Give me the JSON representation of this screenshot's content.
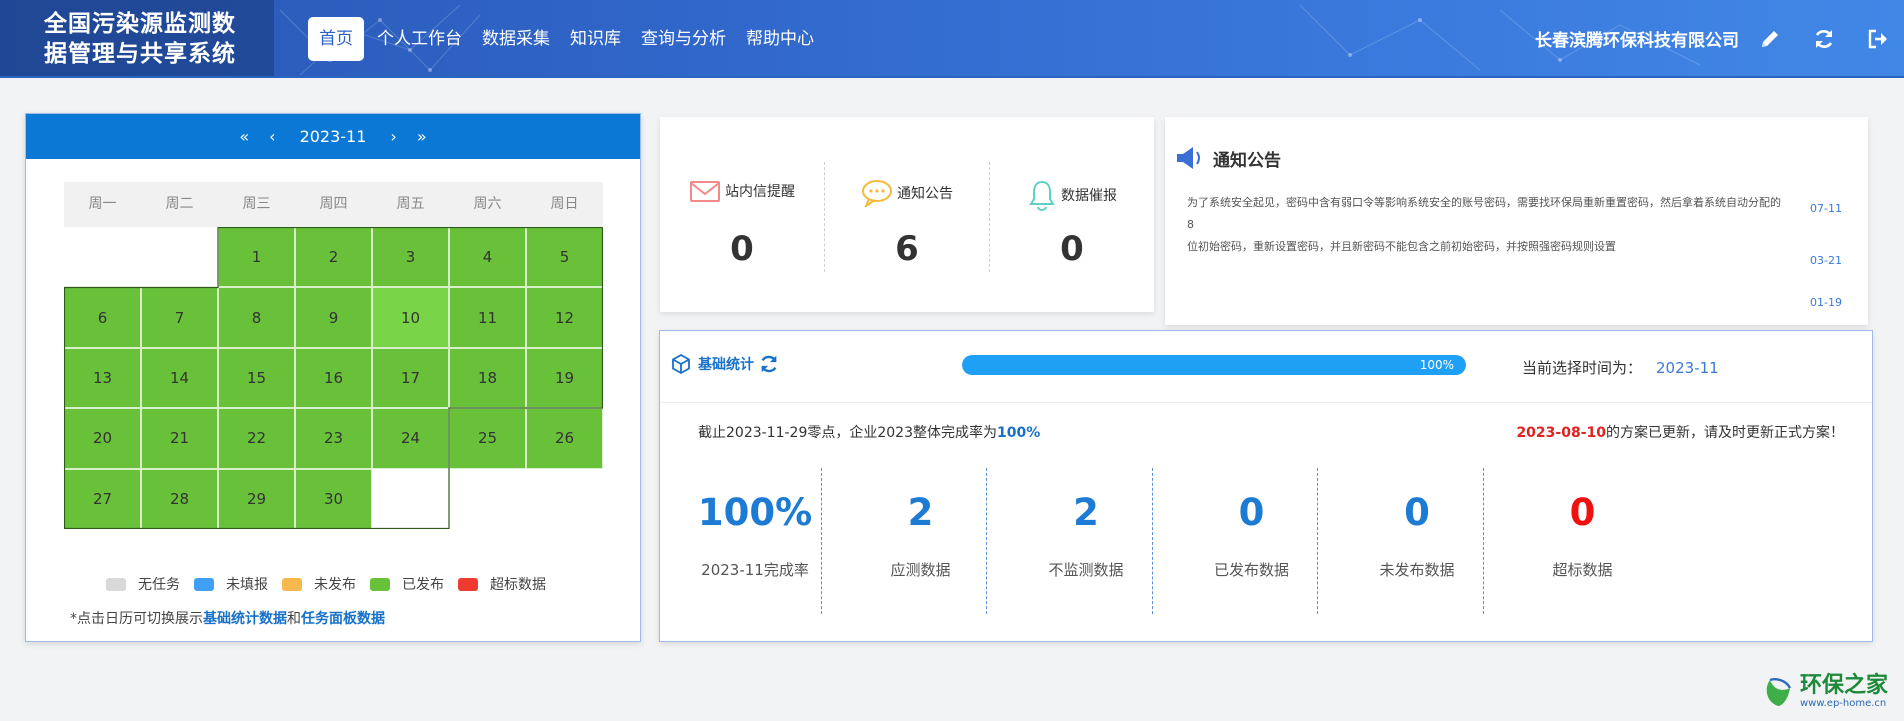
{
  "header": {
    "logo_line1": "全国污染源监测数",
    "logo_line2": "据管理与共享系统",
    "nav": [
      {
        "label": "首页",
        "active": true
      },
      {
        "label": "个人工作台"
      },
      {
        "label": "数据采集"
      },
      {
        "label": "知识库"
      },
      {
        "label": "查询与分析"
      },
      {
        "label": "帮助中心"
      }
    ],
    "company": "长春滨腾环保科技有限公司",
    "icons": [
      "pencil-icon",
      "refresh-icon",
      "logout-icon"
    ]
  },
  "calendar": {
    "prev_year": "«",
    "prev_month": "‹",
    "month": "2023-11",
    "next_month": "›",
    "next_year": "»",
    "weekdays": [
      "周一",
      "周二",
      "周三",
      "周四",
      "周五",
      "周六",
      "周日"
    ],
    "first_weekday_index": 2,
    "days": [
      "1",
      "2",
      "3",
      "4",
      "5",
      "6",
      "7",
      "8",
      "9",
      "10",
      "11",
      "12",
      "13",
      "14",
      "15",
      "16",
      "17",
      "18",
      "19",
      "20",
      "21",
      "22",
      "23",
      "24",
      "25",
      "26",
      "27",
      "28",
      "29",
      "30"
    ],
    "current_day": "10",
    "day_color": "#69c13a",
    "legend": [
      {
        "label": "无任务",
        "color": "#d9d9d9"
      },
      {
        "label": "未填报",
        "color": "#40a0f8"
      },
      {
        "label": "未发布",
        "color": "#f7b84e"
      },
      {
        "label": "已发布",
        "color": "#67c23a"
      },
      {
        "label": "超标数据",
        "color": "#ee3a30"
      }
    ],
    "note_prefix": "*点击日历可切换展示",
    "note_link1": "基础统计数据",
    "note_and": "和",
    "note_link2": "任务面板数据"
  },
  "messages": [
    {
      "label": "站内信提醒",
      "count": "0",
      "icon": "mail-icon"
    },
    {
      "label": "通知公告",
      "count": "6",
      "icon": "chat-bubble-icon"
    },
    {
      "label": "数据催报",
      "count": "0",
      "icon": "bell-icon"
    }
  ],
  "notice": {
    "title": "通知公告",
    "line1": "为了系统安全起见，密码中含有弱口令等影响系统安全的账号密码，需要找环保局重新重置密码，然后拿着系统自动分配的8",
    "line2": "位初始密码，重新设置密码，并且新密码不能包含之前初始密码，并按照强密码规则设置",
    "dates": [
      "07-11",
      "03-21",
      "01-19"
    ]
  },
  "stats": {
    "title": "基础统计",
    "progress_label": "100%",
    "progress_value": 100,
    "current_time_label": "当前选择时间为：",
    "current_time_value": "2023-11",
    "info_left_prefix": "截止2023-11-29零点，企业2023整体完成率为",
    "info_left_value": "100%",
    "info_right_date": "2023-08-10",
    "info_right_suffix": "的方案已更新，请及时更新正式方案！",
    "items": [
      {
        "value": "100%",
        "label": "2023-11完成率",
        "color": "#1d7bd4"
      },
      {
        "value": "2",
        "label": "应测数据",
        "color": "#1d7bd4"
      },
      {
        "value": "2",
        "label": "不监测数据",
        "color": "#1d7bd4"
      },
      {
        "value": "0",
        "label": "已发布数据",
        "color": "#1d7bd4"
      },
      {
        "value": "0",
        "label": "未发布数据",
        "color": "#1d7bd4"
      },
      {
        "value": "0",
        "label": "超标数据",
        "color": "#f01010"
      }
    ]
  },
  "watermark": {
    "name": "环保之家",
    "url": "www.ep-home.cn"
  }
}
